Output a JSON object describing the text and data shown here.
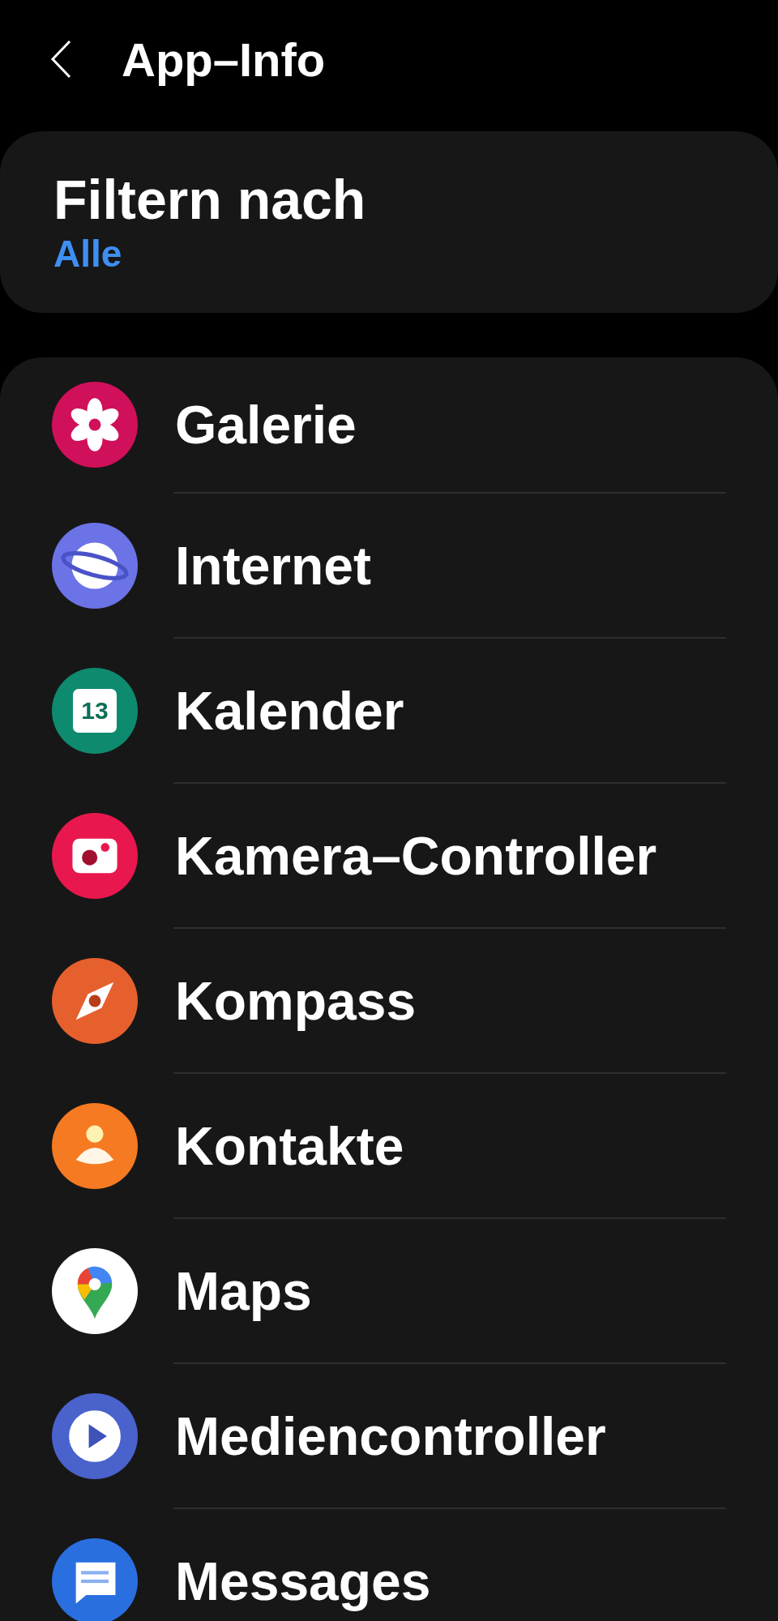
{
  "header": {
    "title": "App–Info"
  },
  "filter": {
    "title": "Filtern nach",
    "value": "Alle"
  },
  "apps": [
    {
      "name": "Galerie",
      "kind": "gallery"
    },
    {
      "name": "Internet",
      "kind": "internet"
    },
    {
      "name": "Kalender",
      "kind": "calendar",
      "icon_text": "13"
    },
    {
      "name": "Kamera–Controller",
      "kind": "camera"
    },
    {
      "name": "Kompass",
      "kind": "compass"
    },
    {
      "name": "Kontakte",
      "kind": "contacts"
    },
    {
      "name": "Maps",
      "kind": "maps"
    },
    {
      "name": "Mediencontroller",
      "kind": "media"
    },
    {
      "name": "Messages",
      "kind": "messages"
    }
  ]
}
